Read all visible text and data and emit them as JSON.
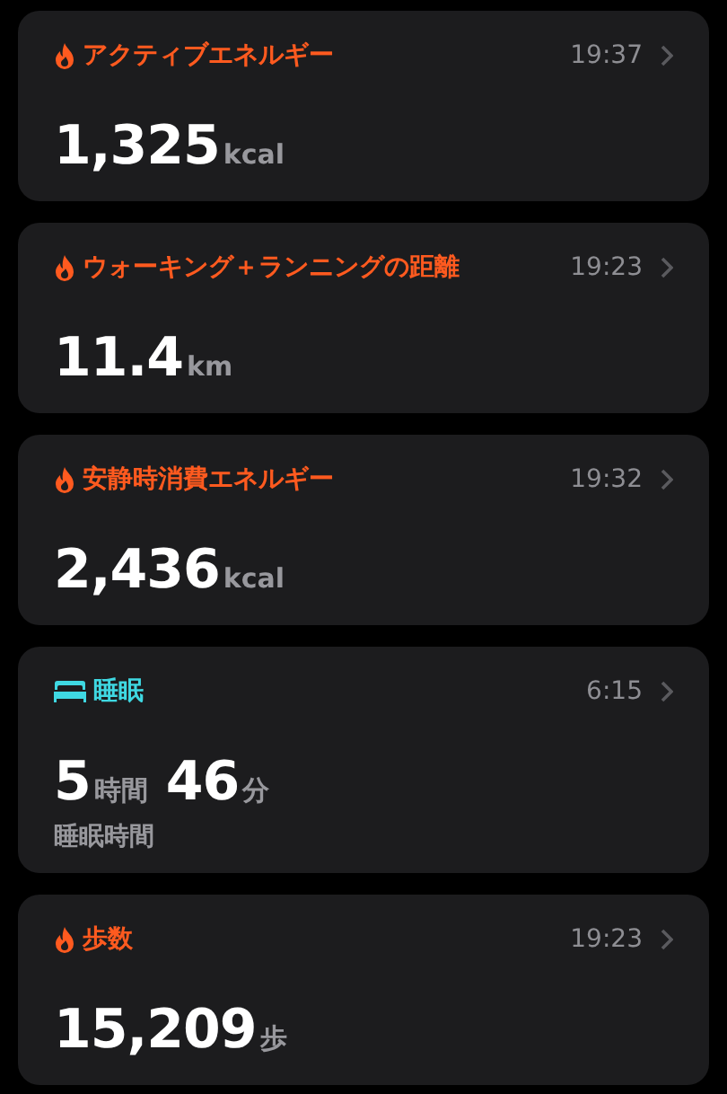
{
  "cards": [
    {
      "kind": "fire",
      "color": "#ff5a1f",
      "title": "アクティブエネルギー",
      "time": "19:37",
      "value": [
        {
          "number": "1,325",
          "unit": "kcal"
        }
      ]
    },
    {
      "kind": "fire",
      "color": "#ff5a1f",
      "title": "ウォーキング＋ランニングの距離",
      "time": "19:23",
      "value": [
        {
          "number": "11.4",
          "unit": "km"
        }
      ]
    },
    {
      "kind": "fire",
      "color": "#ff5a1f",
      "title": "安静時消費エネルギー",
      "time": "19:32",
      "value": [
        {
          "number": "2,436",
          "unit": "kcal"
        }
      ]
    },
    {
      "kind": "bed",
      "color": "#3fd8e2",
      "title": "睡眠",
      "time": "6:15",
      "value": [
        {
          "number": "5",
          "unit": "時間"
        },
        {
          "number": "46",
          "unit": "分"
        }
      ],
      "caption": "睡眠時間"
    },
    {
      "kind": "fire",
      "color": "#ff5a1f",
      "title": "歩数",
      "time": "19:23",
      "value": [
        {
          "number": "15,209",
          "unit": "歩"
        }
      ]
    }
  ]
}
